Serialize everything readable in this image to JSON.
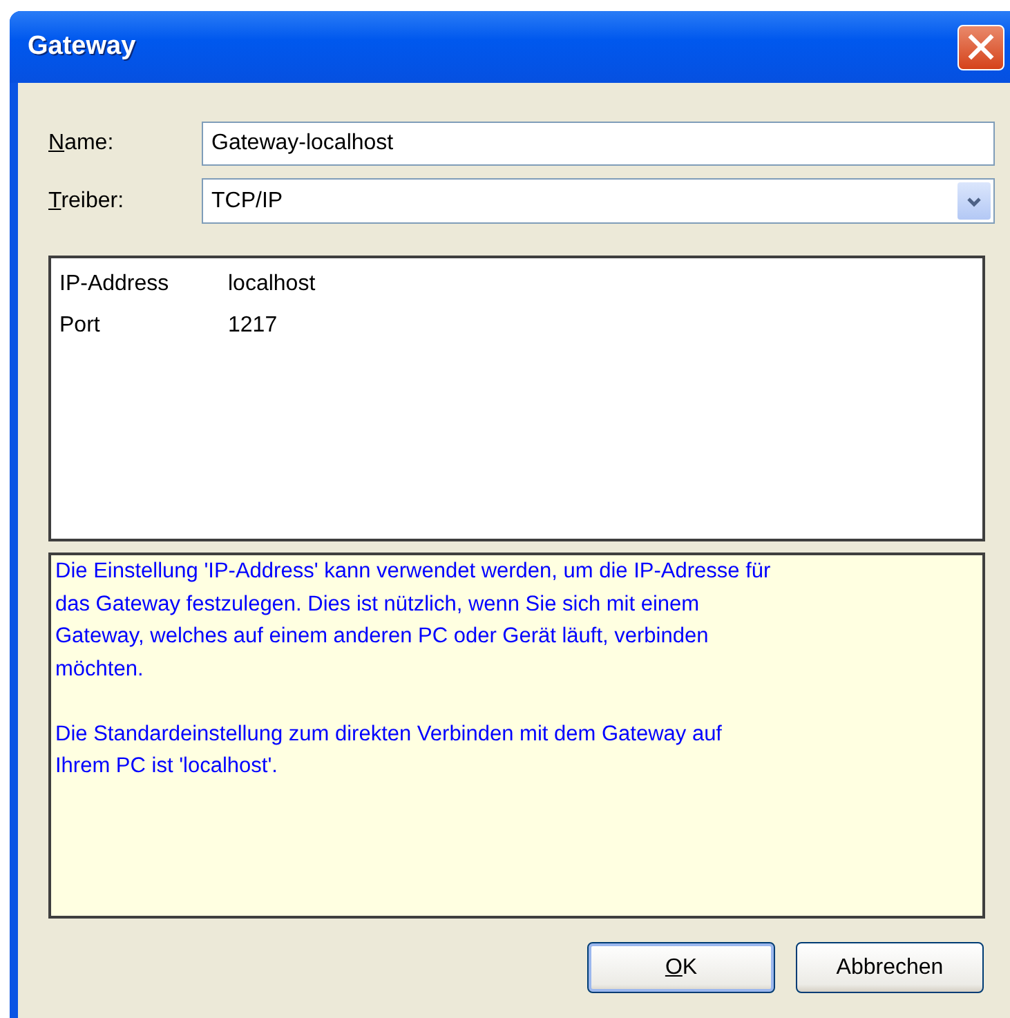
{
  "window": {
    "title": "Gateway"
  },
  "fields": [
    {
      "kind": "text",
      "label": "Name:",
      "value": "Gateway-localhost"
    },
    {
      "kind": "dropdown",
      "label": "Treiber:",
      "value": "TCP/IP"
    }
  ],
  "properties": [
    {
      "name": "IP-Address",
      "value": "localhost"
    },
    {
      "name": "Port",
      "value": "1217"
    }
  ],
  "help": [
    [
      "Die Einstellung 'IP-Address' kann verwendet werden, um die IP-Adresse für",
      "das Gateway festzulegen. Dies ist nützlich, wenn Sie sich mit einem",
      "Gateway, welches auf einem anderen PC oder Gerät läuft, verbinden",
      "möchten."
    ],
    [
      "Die Standardeinstellung zum direkten Verbinden mit dem Gateway auf",
      "Ihrem PC ist  'localhost'."
    ]
  ],
  "buttons": [
    {
      "label": "OK",
      "default": true
    },
    {
      "label": "Abbrechen",
      "default": false
    }
  ]
}
